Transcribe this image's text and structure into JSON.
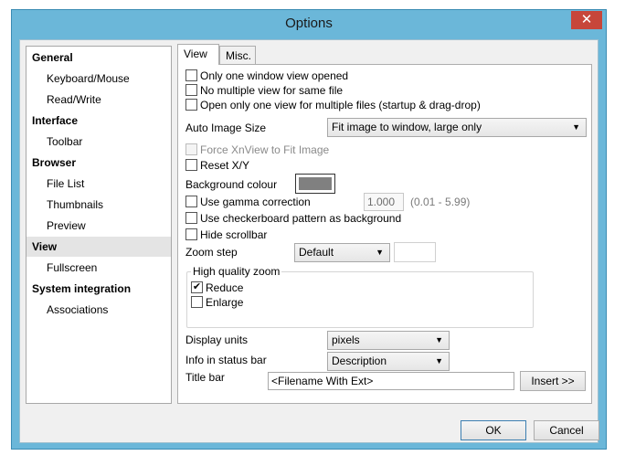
{
  "window": {
    "title": "Options",
    "close_glyph": "✕"
  },
  "sidebar": {
    "items": [
      {
        "label": "General",
        "kind": "header"
      },
      {
        "label": "Keyboard/Mouse",
        "kind": "sub"
      },
      {
        "label": "Read/Write",
        "kind": "sub"
      },
      {
        "label": "Interface",
        "kind": "header"
      },
      {
        "label": "Toolbar",
        "kind": "sub"
      },
      {
        "label": "Browser",
        "kind": "header"
      },
      {
        "label": "File List",
        "kind": "sub"
      },
      {
        "label": "Thumbnails",
        "kind": "sub"
      },
      {
        "label": "Preview",
        "kind": "sub"
      },
      {
        "label": "View",
        "kind": "header",
        "selected": true
      },
      {
        "label": "Fullscreen",
        "kind": "sub"
      },
      {
        "label": "System integration",
        "kind": "header"
      },
      {
        "label": "Associations",
        "kind": "sub"
      }
    ]
  },
  "tabs": [
    {
      "label": "View",
      "active": true
    },
    {
      "label": "Misc.",
      "active": false
    }
  ],
  "view": {
    "only_one_window": {
      "label": "Only one window view opened",
      "checked": false
    },
    "no_multiple_view": {
      "label": "No multiple view for same file",
      "checked": false
    },
    "open_only_one": {
      "label": "Open only one view for multiple files (startup & drag-drop)",
      "checked": false
    },
    "auto_image_size": {
      "label": "Auto Image Size",
      "value": "Fit image to window, large only"
    },
    "force_fit": {
      "label": "Force XnView to Fit Image",
      "checked": false,
      "disabled": true
    },
    "reset_xy": {
      "label": "Reset X/Y",
      "checked": false
    },
    "background_colour": {
      "label": "Background colour",
      "color": "#808080"
    },
    "gamma": {
      "label": "Use gamma correction",
      "checked": false,
      "value": "1.000",
      "range": "(0.01 - 5.99)"
    },
    "checkerboard": {
      "label": "Use checkerboard pattern as background",
      "checked": false
    },
    "hide_scrollbar": {
      "label": "Hide scrollbar",
      "checked": false
    },
    "zoom_step": {
      "label": "Zoom step",
      "value": "Default",
      "extra_value": ""
    },
    "hq_zoom": {
      "title": "High quality zoom",
      "reduce": {
        "label": "Reduce",
        "checked": true
      },
      "enlarge": {
        "label": "Enlarge",
        "checked": false
      }
    },
    "display_units": {
      "label": "Display units",
      "value": "pixels"
    },
    "status_bar": {
      "label": "Info in status bar",
      "value": "Description"
    },
    "title_bar": {
      "label": "Title bar",
      "value": "<Filename With Ext>",
      "insert_label": "Insert >>"
    }
  },
  "footer": {
    "ok_label": "OK",
    "cancel_label": "Cancel"
  },
  "icons": {
    "check": "✔",
    "chevron": "▼"
  }
}
